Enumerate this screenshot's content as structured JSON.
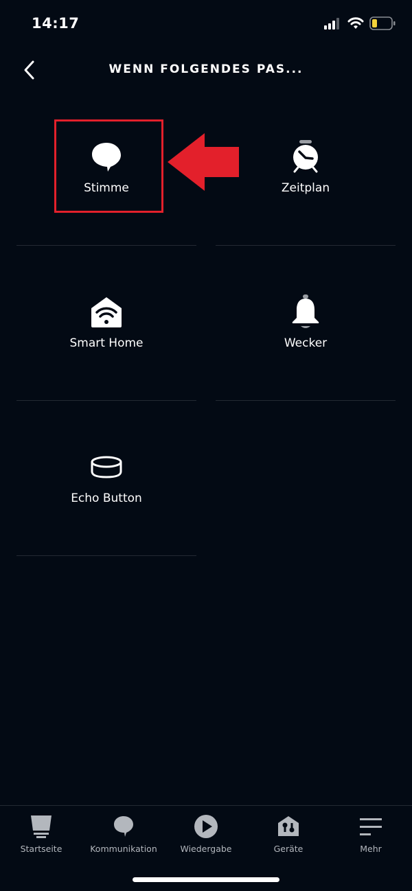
{
  "status_bar": {
    "time": "14:17",
    "signal_icon": "cellular-signal-icon",
    "wifi_icon": "wifi-icon",
    "battery_icon": "battery-low-icon",
    "battery_color": "#f5d33a"
  },
  "header": {
    "back_icon": "chevron-left-icon",
    "title": "WENN FOLGENDES PAS..."
  },
  "triggers": [
    {
      "label": "Stimme",
      "icon": "speech-bubble-icon",
      "highlighted": true
    },
    {
      "label": "Zeitplan",
      "icon": "alarm-clock-icon"
    },
    {
      "label": "Smart Home",
      "icon": "smart-home-icon"
    },
    {
      "label": "Wecker",
      "icon": "bell-icon"
    },
    {
      "label": "Echo Button",
      "icon": "echo-button-icon"
    }
  ],
  "annotation": {
    "box_color": "#e3202b",
    "arrow_color": "#e3202b",
    "arrow_direction": "left"
  },
  "tabbar": {
    "items": [
      {
        "label": "Startseite",
        "icon": "home-lamp-icon"
      },
      {
        "label": "Kommunikation",
        "icon": "chat-bubble-icon"
      },
      {
        "label": "Wiedergabe",
        "icon": "play-icon"
      },
      {
        "label": "Geräte",
        "icon": "devices-house-icon"
      },
      {
        "label": "Mehr",
        "icon": "menu-icon"
      }
    ]
  }
}
